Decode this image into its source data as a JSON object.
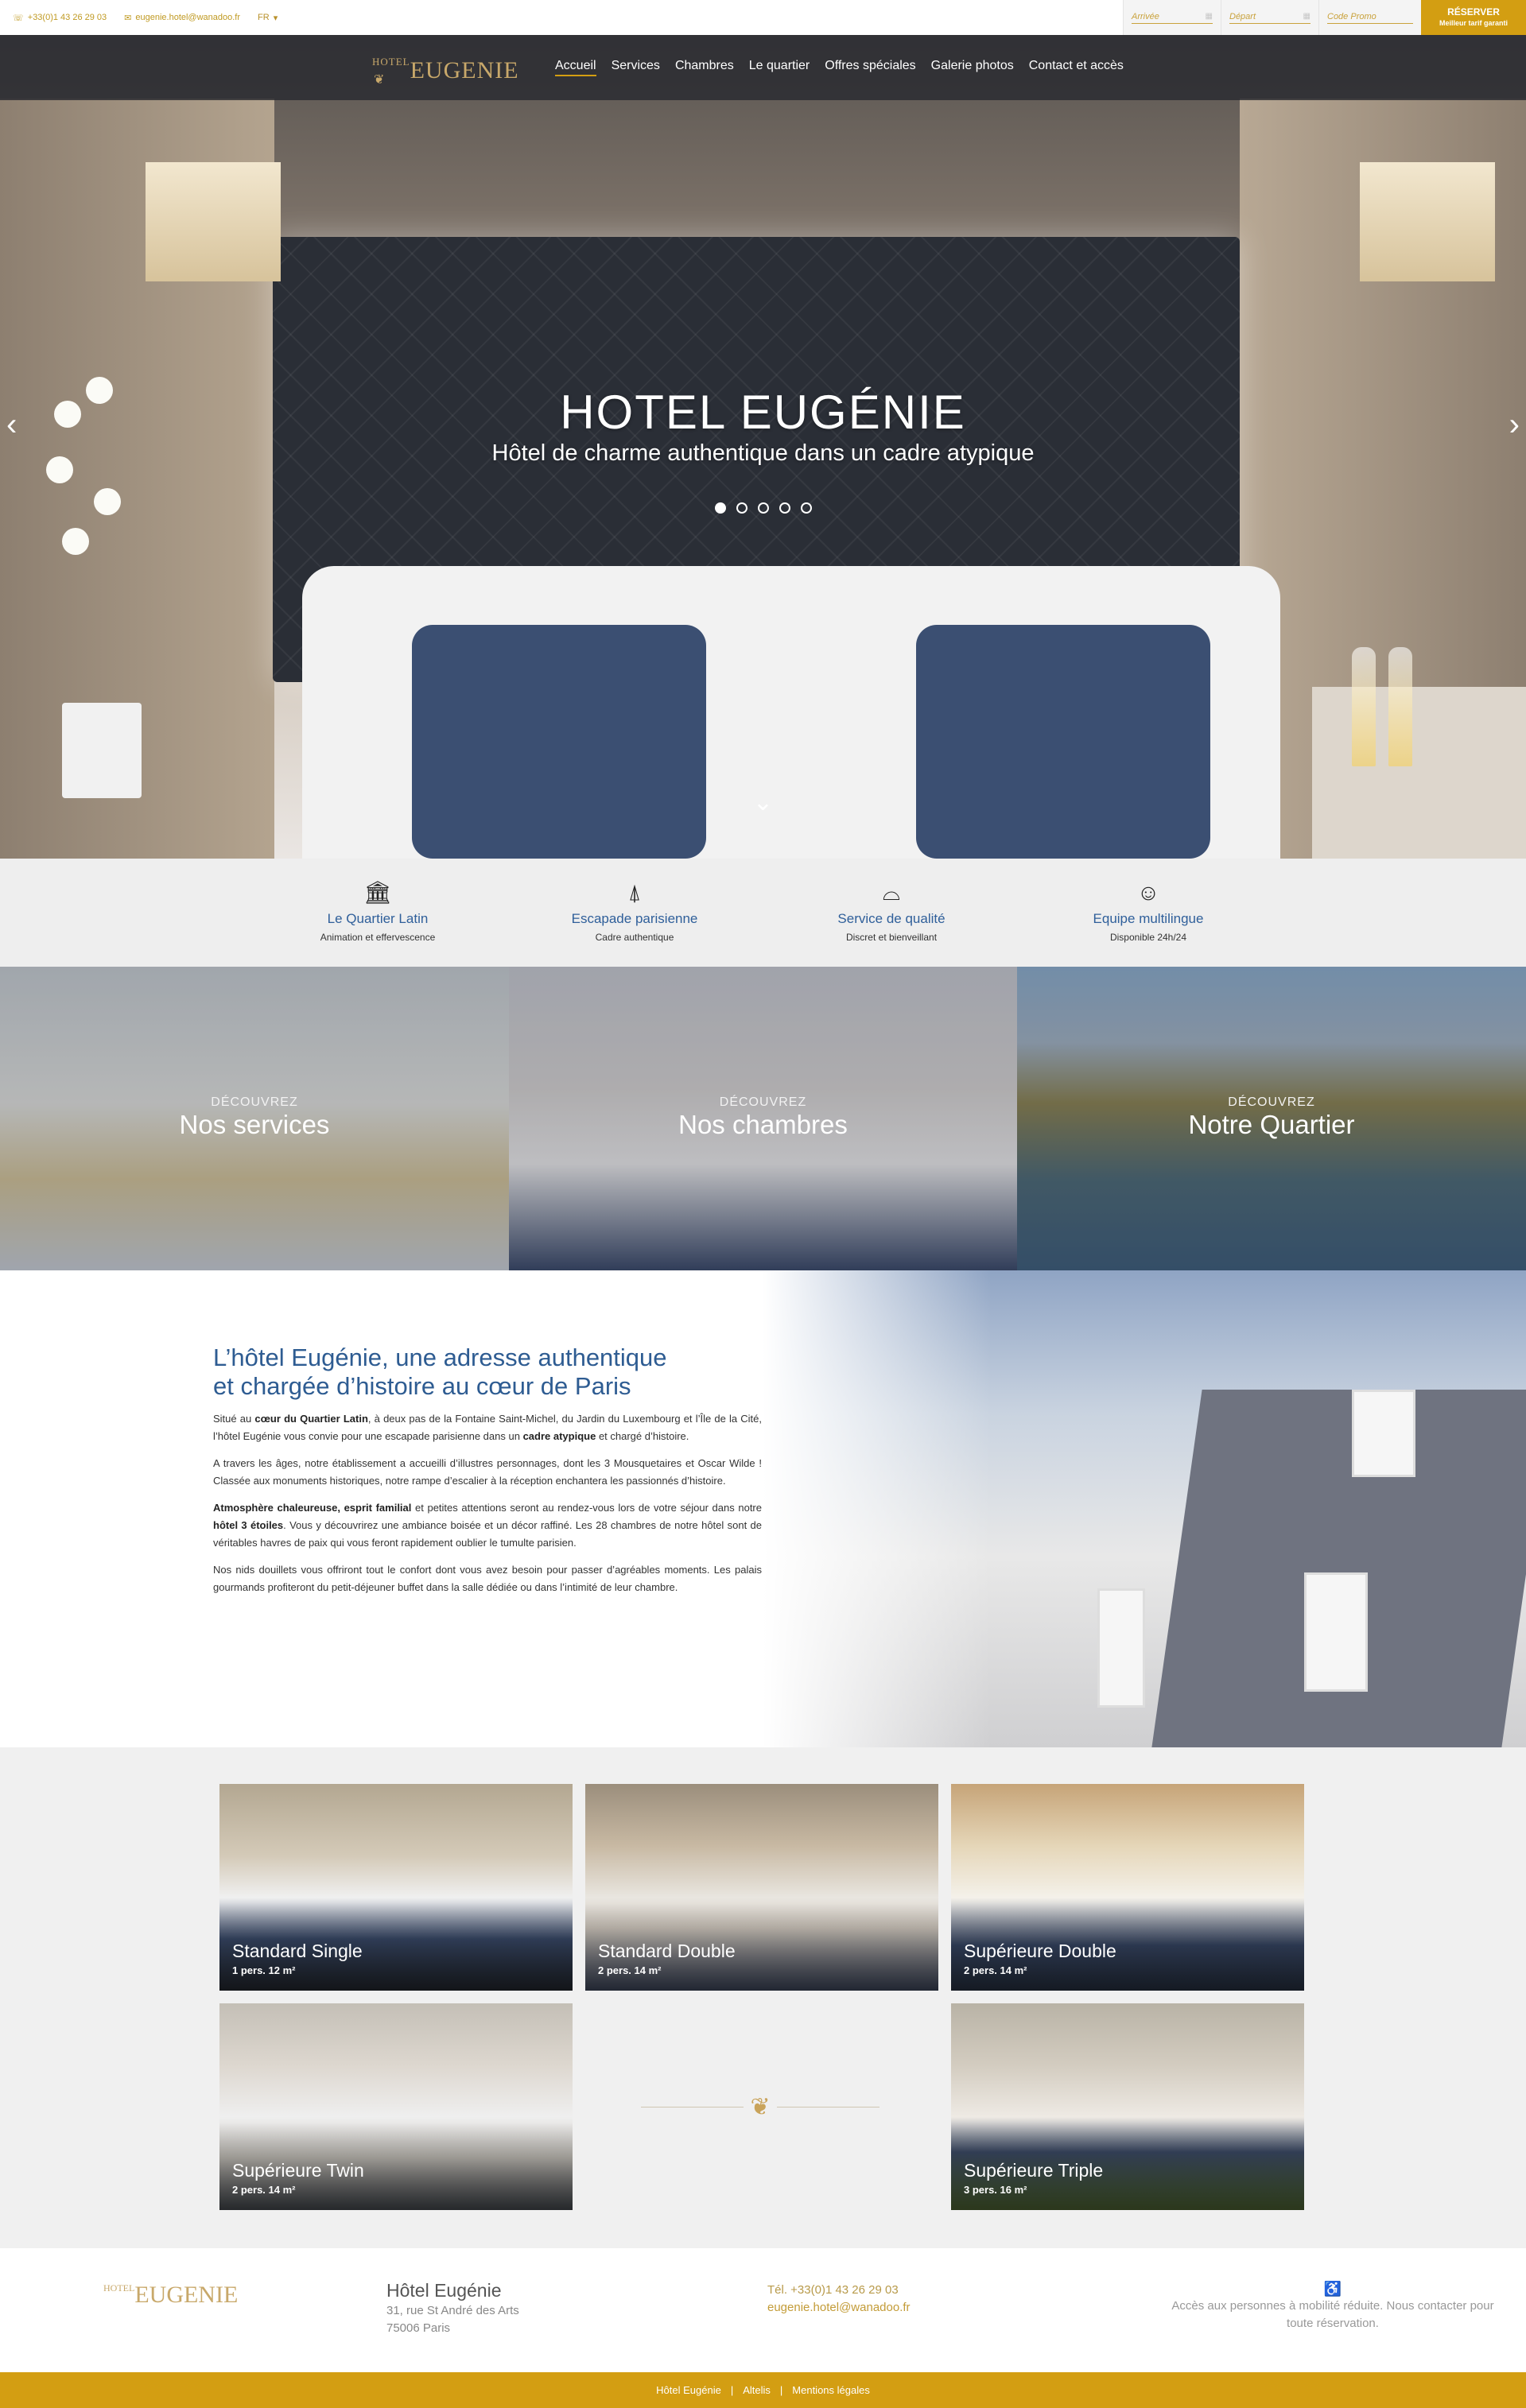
{
  "topbar": {
    "phone": "+33(0)1 43 26 29 03",
    "email": "eugenie.hotel@wanadoo.fr",
    "language": "FR",
    "arrival_placeholder": "Arrivée",
    "departure_placeholder": "Départ",
    "promo_placeholder": "Code Promo",
    "reserve_label": "RÉSERVER",
    "reserve_sub": "Meilleur tarif garanti"
  },
  "logo": {
    "small": "HOTEL",
    "name": "EUGENIE"
  },
  "nav": {
    "items": [
      "Accueil",
      "Services",
      "Chambres",
      "Le quartier",
      "Offres spéciales",
      "Galerie photos",
      "Contact et accès"
    ],
    "active": 0
  },
  "hero": {
    "title": "HOTEL EUGÉNIE",
    "subtitle": "Hôtel de charme authentique dans un cadre atypique",
    "slides": 5,
    "active_slide": 0
  },
  "features": [
    {
      "icon": "monument-icon",
      "title": "Le Quartier Latin",
      "subtitle": "Animation et effervescence"
    },
    {
      "icon": "eiffel-tower-icon",
      "title": "Escapade parisienne",
      "subtitle": "Cadre authentique"
    },
    {
      "icon": "cloche-icon",
      "title": "Service de qualité",
      "subtitle": "Discret et bienveillant"
    },
    {
      "icon": "concierge-icon",
      "title": "Equipe multilingue",
      "subtitle": "Disponible 24h/24"
    }
  ],
  "discover": {
    "prefix": "DÉCOUVREZ",
    "tiles": [
      "Nos services",
      "Nos chambres",
      "Notre Quartier"
    ]
  },
  "about": {
    "title_line1": "L’hôtel Eugénie, une adresse authentique",
    "title_line2": "et chargée d’histoire au cœur de Paris",
    "p1_a": "Situé au ",
    "p1_b": "cœur du Quartier Latin",
    "p1_c": ", à deux pas de la Fontaine Saint-Michel, du Jardin du Luxembourg et l’Île de la Cité, l’hôtel Eugénie vous convie pour une escapade parisienne dans un ",
    "p1_d": "cadre atypique",
    "p1_e": " et chargé d’histoire.",
    "p2": "A travers les âges, notre établissement a accueilli d’illustres personnages, dont les 3 Mousquetaires et Oscar Wilde ! Classée aux monuments historiques, notre rampe d’escalier à la réception enchantera les passionnés d’histoire.",
    "p3_a": "Atmosphère chaleureuse, esprit familial",
    "p3_b": " et petites attentions seront au rendez-vous lors de votre séjour dans notre ",
    "p3_c": "hôtel 3 étoiles",
    "p3_d": ". Vous y découvrirez une ambiance boisée et un décor raffiné. Les 28 chambres de notre hôtel sont de véritables havres de paix qui vous feront rapidement oublier le tumulte parisien.",
    "p4": "Nos nids douillets vous offriront tout le confort dont vous avez besoin pour passer d’agréables moments. Les palais gourmands profiteront du petit-déjeuner buffet dans la salle dédiée ou dans l’intimité de leur chambre."
  },
  "rooms": [
    {
      "name": "Standard Single",
      "info": "1 pers. 12 m²"
    },
    {
      "name": "Standard Double",
      "info": "2 pers. 14 m²"
    },
    {
      "name": "Supérieure Double",
      "info": "2 pers. 14 m²"
    },
    {
      "name": "Supérieure Twin",
      "info": "2 pers. 14 m²"
    },
    {
      "name": "Supérieure Triple",
      "info": "3 pers. 16 m²"
    }
  ],
  "footer": {
    "hotel_name": "Hôtel Eugénie",
    "address1": "31, rue St André des Arts",
    "address2": "75006 Paris",
    "tel": "Tél. +33(0)1 43 26 29 03",
    "email": "eugenie.hotel@wanadoo.fr",
    "access_icon": "wheelchair-icon",
    "access_text": "Accès aux personnes à mobilité réduite. Nous contacter pour toute réservation.",
    "links": [
      "Hôtel Eugénie",
      "Altelis",
      "Mentions légales"
    ]
  },
  "colors": {
    "gold": "#d39e12",
    "blue": "#2f5f9a"
  }
}
